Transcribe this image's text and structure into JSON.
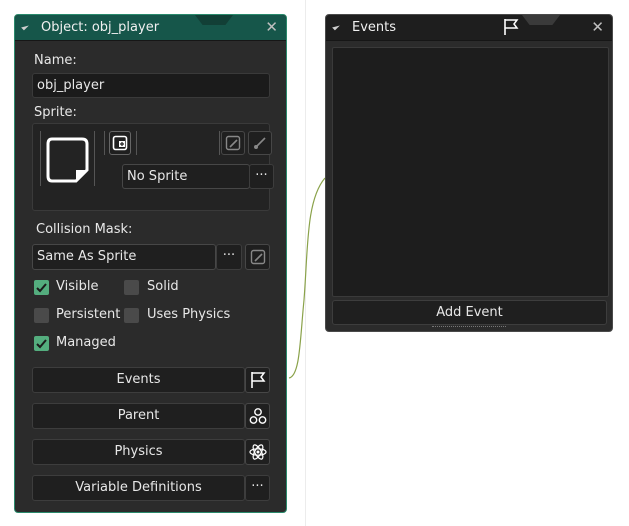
{
  "object_window": {
    "title": "Object: obj_player",
    "close_glyph": "✕",
    "name_label": "Name:",
    "name_value": "obj_player",
    "sprite_label": "Sprite:",
    "sprite_value": "No Sprite",
    "sprite_menu_glyph": "···",
    "collision_label": "Collision Mask:",
    "collision_value": "Same As Sprite",
    "collision_menu_glyph": "···",
    "checkboxes": {
      "visible": {
        "label": "Visible",
        "checked": true
      },
      "solid": {
        "label": "Solid",
        "checked": false
      },
      "persistent": {
        "label": "Persistent",
        "checked": false
      },
      "uses_physics": {
        "label": "Uses Physics",
        "checked": false
      },
      "managed": {
        "label": "Managed",
        "checked": true
      }
    },
    "buttons": {
      "events": "Events",
      "parent": "Parent",
      "physics": "Physics",
      "variable_definitions": "Variable Definitions",
      "variable_definitions_glyph": "···"
    }
  },
  "events_window": {
    "title": "Events",
    "close_glyph": "✕",
    "add_event_label": "Add Event"
  },
  "colors": {
    "window_bg": "#2b2b2b",
    "accent": "#2a8a6c",
    "checkbox_on": "#54ad7e"
  },
  "icons": [
    "collapse-triangle-icon",
    "close-icon",
    "flag-icon",
    "sprite-thumbnail-icon",
    "new-sprite-icon",
    "edit-sprite-icon",
    "brush-icon",
    "parent-hierarchy-icon",
    "atom-icon",
    "ellipsis-icon",
    "checkmark-icon"
  ]
}
